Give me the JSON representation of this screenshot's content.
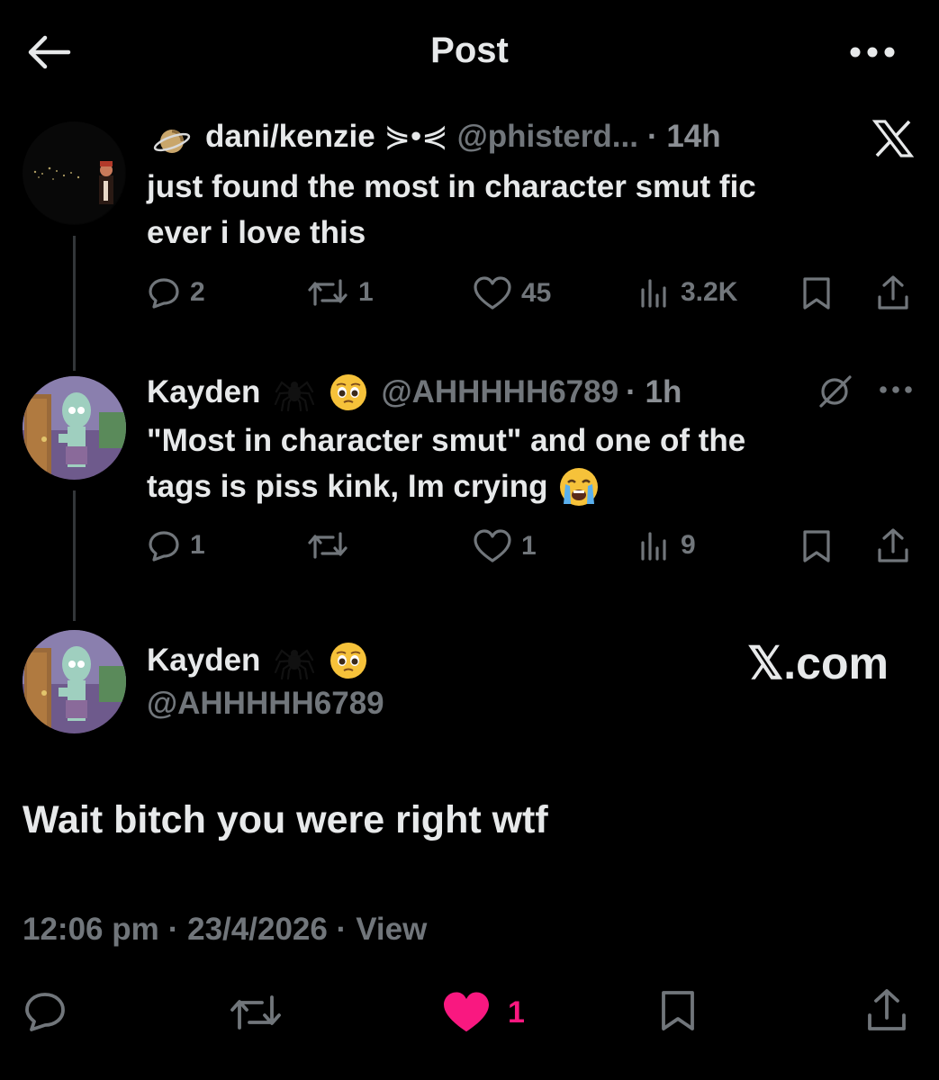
{
  "header": {
    "title": "Post"
  },
  "tweets": [
    {
      "name": "dani/kenzie",
      "name_emoji": "⋟•⋞",
      "handle": "@phisterd...",
      "time": "· 14h",
      "text_line1": "just found the most in character smut fic",
      "text_line2": "ever i love this",
      "replies": "2",
      "retweets": "1",
      "likes": "45",
      "views": "3.2K"
    },
    {
      "name": "Kayden",
      "handle": "@AHHHHH6789",
      "time": "· 1h",
      "text_line1": "\"Most in character smut\" and one of the",
      "text_line2": "tags is piss kink, Im crying",
      "replies": "1",
      "retweets": "",
      "likes": "1",
      "views": "9"
    }
  ],
  "main_post": {
    "name": "Kayden",
    "handle": "@AHHHHH6789",
    "source_label": "𝕏.com",
    "text": "Wait bitch you were right wtf",
    "time": "12:06 pm",
    "date": "· 23/4/2026 ·",
    "view_label": "View",
    "likes": "1"
  },
  "colors": {
    "like_active": "#f91880",
    "muted": "#71767b",
    "text": "#e7e9ea"
  },
  "icons": [
    "back-arrow-icon",
    "more-icon",
    "x-logo-icon",
    "grok-icon",
    "reply-icon",
    "retweet-icon",
    "like-icon",
    "views-icon",
    "bookmark-icon",
    "share-icon",
    "spider-emoji",
    "pleading-emoji",
    "crying-emoji",
    "planet-emoji"
  ]
}
